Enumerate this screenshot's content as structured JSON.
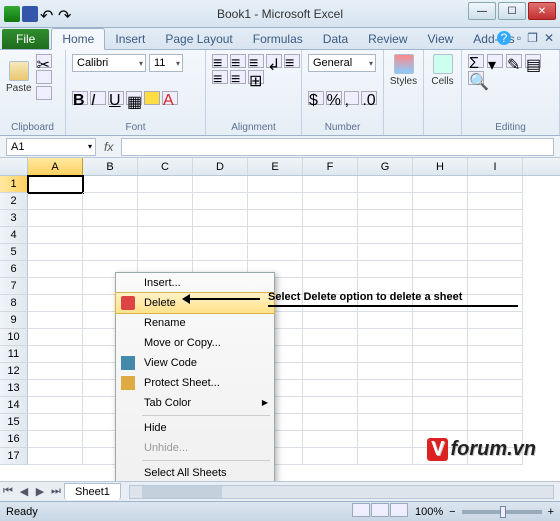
{
  "window": {
    "title": "Book1 - Microsoft Excel"
  },
  "tabs": {
    "file": "File",
    "list": [
      "Home",
      "Insert",
      "Page Layout",
      "Formulas",
      "Data",
      "Review",
      "View",
      "Add-Ins"
    ],
    "active": "Home"
  },
  "ribbon": {
    "clipboard": {
      "label": "Clipboard",
      "paste": "Paste"
    },
    "font": {
      "label": "Font",
      "family": "Calibri",
      "size": "11"
    },
    "alignment": {
      "label": "Alignment"
    },
    "number": {
      "label": "Number",
      "format": "General"
    },
    "styles": {
      "label": "Styles",
      "btn": "Styles"
    },
    "cells": {
      "label": "Cells",
      "btn": "Cells"
    },
    "editing": {
      "label": "Editing"
    }
  },
  "namebox": "A1",
  "fx": "fx",
  "columns": [
    "A",
    "B",
    "C",
    "D",
    "E",
    "F",
    "G",
    "H",
    "I"
  ],
  "rows": [
    "1",
    "2",
    "3",
    "4",
    "5",
    "6",
    "7",
    "8",
    "9",
    "10",
    "11",
    "12",
    "13",
    "14",
    "15",
    "16",
    "17"
  ],
  "context_menu": {
    "insert": "Insert...",
    "delete": "Delete",
    "rename": "Rename",
    "move": "Move or Copy...",
    "viewcode": "View Code",
    "protect": "Protect Sheet...",
    "tabcolor": "Tab Color",
    "hide": "Hide",
    "unhide": "Unhide...",
    "selectall": "Select All Sheets"
  },
  "annotation": "Select Delete option to delete a sheet",
  "sheet_tabs": [
    "Sheet1"
  ],
  "status": {
    "ready": "Ready",
    "zoom": "100%"
  },
  "watermark": {
    "v": "V",
    "rest": "forum.vn"
  }
}
